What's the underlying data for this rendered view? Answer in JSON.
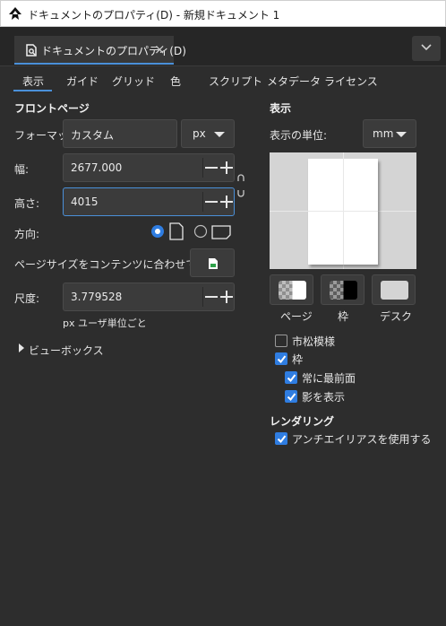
{
  "window": {
    "title": "ドキュメントのプロパティ(D) - 新規ドキュメント 1"
  },
  "doc_tab": {
    "label": "ドキュメントのプロパティ(D)",
    "close": "×"
  },
  "tabs": [
    "表示",
    "ガイド",
    "グリッド",
    "色",
    "スクリプト",
    "メタデータ",
    "ライセンス"
  ],
  "front_page": {
    "heading": "フロントページ",
    "format_label": "フォーマット:",
    "format_value": "カスタム",
    "format_unit": "px",
    "width_label": "幅:",
    "width_value": "2677.000",
    "height_label": "高さ:",
    "height_value": "4015",
    "orientation_label": "方向:",
    "resize_label": "ページサイズをコンテンツに合わせて変更:",
    "scale_label": "尺度:",
    "scale_value": "3.779528",
    "scale_hint": "px ユーザ単位ごと",
    "viewbox_label": "ビューボックス"
  },
  "display": {
    "heading": "表示",
    "unit_label": "表示の単位:",
    "unit_value": "mm",
    "swatch_labels": [
      "ページ",
      "枠",
      "デスク"
    ],
    "checker_label": "市松模様",
    "border_label": "枠",
    "border_on_top_label": "常に最前面",
    "show_shadow_label": "影を表示",
    "rendering_heading": "レンダリング",
    "antialias_label": "アンチエイリアスを使用する"
  },
  "colors": {
    "accent": "#4a90d9",
    "checkbox": "#2f7de1",
    "background": "#2d2d2d"
  }
}
